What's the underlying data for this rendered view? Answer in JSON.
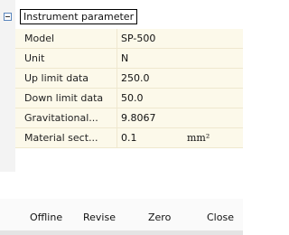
{
  "panel": {
    "group_title": "Instrument parameter",
    "rows": [
      {
        "label": "Model",
        "value": "SP-500",
        "unit": ""
      },
      {
        "label": "Unit",
        "value": "N",
        "unit": ""
      },
      {
        "label": "Up limit data",
        "value": "250.0",
        "unit": ""
      },
      {
        "label": "Down limit data",
        "value": "50.0",
        "unit": ""
      },
      {
        "label": "Gravitational...",
        "value": "9.8067",
        "unit": ""
      },
      {
        "label": "Material sect...",
        "value": "0.1",
        "unit": "mm²"
      }
    ]
  },
  "toolbar": {
    "offline_label": "Offline",
    "revise_label": "Revise",
    "zero_label": "Zero",
    "close_label": "Close"
  }
}
